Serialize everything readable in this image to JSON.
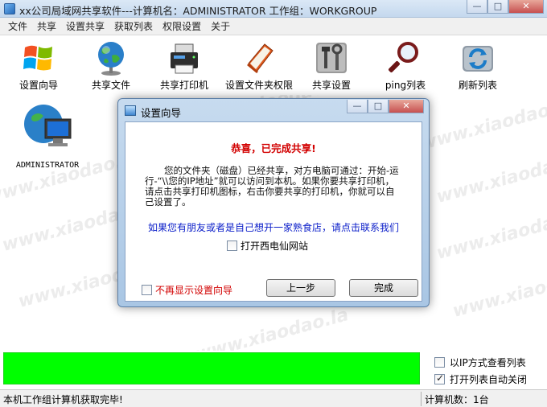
{
  "window": {
    "title": "xx公司局域网共享软件---计算机名：ADMINISTRATOR  工作组：WORKGROUP"
  },
  "menu": [
    "文件",
    "共享",
    "设置共享",
    "获取列表",
    "权限设置",
    "关于"
  ],
  "toolbar": {
    "items": [
      {
        "label": "设置向导",
        "icon": "windows-logo-icon"
      },
      {
        "label": "共享文件",
        "icon": "globe-icon"
      },
      {
        "label": "共享打印机",
        "icon": "printer-icon"
      },
      {
        "label": "设置文件夹权限",
        "icon": "folder-book-icon"
      },
      {
        "label": "共享设置",
        "icon": "tools-icon"
      },
      {
        "label": "ping列表",
        "icon": "magnifier-icon"
      },
      {
        "label": "刷新列表",
        "icon": "refresh-icon"
      }
    ]
  },
  "hosts": [
    {
      "name": "ADMINISTRATOR",
      "icon": "network-computer-icon"
    }
  ],
  "watermark": "www.xiaodao.la",
  "dialog": {
    "title": "设置向导",
    "congrats": "恭喜，已完成共享!",
    "description": "您的文件夹（磁盘）已经共享，对方电脑可通过：开始-运行-“\\\\您的IP地址”就可以访问到本机。如果你要共享打印机，请点击共享打印机图标，右击你要共享的打印机，你就可以自己设置了。",
    "friend_link": "如果您有朋友或者是自己想开一家熟食店，请点击联系我们",
    "open_site_label": "打开西电仙网站",
    "no_show_label": "不再显示设置向导",
    "prev_button": "上一步",
    "finish_button": "完成"
  },
  "options": {
    "ip_view_label": "以IP方式查看列表",
    "ip_view_checked": false,
    "auto_close_label": "打开列表自动关闭",
    "auto_close_checked": true
  },
  "status": {
    "left": "本机工作组计算机获取完毕!",
    "right": "计算机数：1台"
  },
  "colors": {
    "progress": "#00ff00",
    "congrats": "#d20000",
    "link": "#0a1dc9"
  }
}
